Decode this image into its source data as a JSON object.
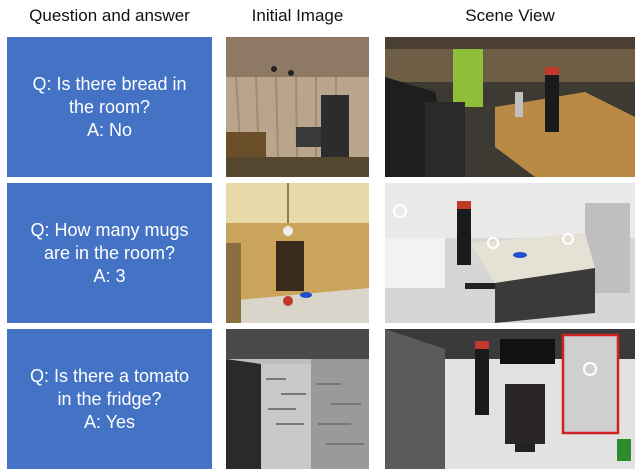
{
  "headers": {
    "col1": "Question and answer",
    "col2": "Initial Image",
    "col3": "Scene View"
  },
  "rows": [
    {
      "question": "Q: Is there bread in\nthe room?",
      "answer": "A: No"
    },
    {
      "question": "Q: How many mugs\nare in the room?",
      "answer": "A: 3"
    },
    {
      "question": "Q: Is there a tomato\nin the fridge?",
      "answer": "A: Yes"
    }
  ],
  "colors": {
    "panel_blue": "#4472c4",
    "highlight_box": "#d02020"
  }
}
